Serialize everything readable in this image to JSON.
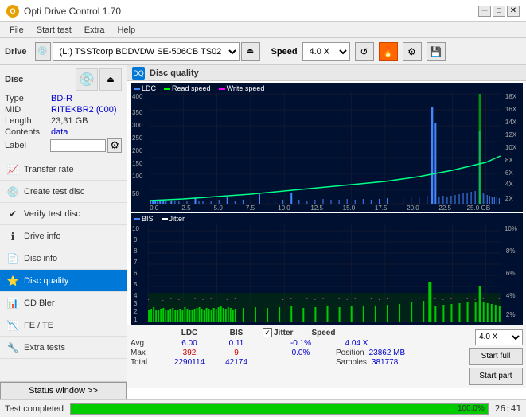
{
  "titlebar": {
    "title": "Opti Drive Control 1.70",
    "logo": "O",
    "min": "─",
    "max": "□",
    "close": "✕"
  },
  "menu": {
    "items": [
      "File",
      "Start test",
      "Extra",
      "Help"
    ]
  },
  "toolbar": {
    "drive_label": "Drive",
    "drive_value": "(L:)  TSSTcorp BDDVDW SE-506CB TS02",
    "speed_label": "Speed",
    "speed_value": "4.0 X"
  },
  "disc": {
    "header": "Disc",
    "type_label": "Type",
    "type_value": "BD-R",
    "mid_label": "MID",
    "mid_value": "RITEKBR2 (000)",
    "length_label": "Length",
    "length_value": "23,31 GB",
    "contents_label": "Contents",
    "contents_value": "data",
    "label_label": "Label",
    "label_value": ""
  },
  "nav": {
    "items": [
      {
        "id": "transfer-rate",
        "label": "Transfer rate",
        "icon": "📈"
      },
      {
        "id": "create-test-disc",
        "label": "Create test disc",
        "icon": "💿"
      },
      {
        "id": "verify-test-disc",
        "label": "Verify test disc",
        "icon": "✔"
      },
      {
        "id": "drive-info",
        "label": "Drive info",
        "icon": "ℹ"
      },
      {
        "id": "disc-info",
        "label": "Disc info",
        "icon": "📄"
      },
      {
        "id": "disc-quality",
        "label": "Disc quality",
        "icon": "⭐",
        "active": true
      },
      {
        "id": "cd-bler",
        "label": "CD Bler",
        "icon": "📊"
      },
      {
        "id": "fe-te",
        "label": "FE / TE",
        "icon": "📉"
      },
      {
        "id": "extra-tests",
        "label": "Extra tests",
        "icon": "🔧"
      }
    ]
  },
  "status_btn": "Status window >>",
  "dq": {
    "title": "Disc quality",
    "legend1": [
      {
        "label": "LDC",
        "color": "#4444ff"
      },
      {
        "label": "Read speed",
        "color": "#00ff00"
      },
      {
        "label": "Write speed",
        "color": "#ff00ff"
      }
    ],
    "legend2": [
      {
        "label": "BIS",
        "color": "#4444ff"
      },
      {
        "label": "Jitter",
        "color": "#ffffff"
      }
    ],
    "y_labels_chart1": [
      "400",
      "350",
      "300",
      "250",
      "200",
      "150",
      "100",
      "50"
    ],
    "y_labels_chart1_right": [
      "18X",
      "16X",
      "14X",
      "12X",
      "10X",
      "8X",
      "6X",
      "4X",
      "2X"
    ],
    "y_labels_chart2": [
      "10",
      "9",
      "8",
      "7",
      "6",
      "5",
      "4",
      "3",
      "2",
      "1"
    ],
    "y_labels_chart2_right": [
      "10%",
      "8%",
      "6%",
      "4%",
      "2%"
    ],
    "x_labels": [
      "0.0",
      "2.5",
      "5.0",
      "7.5",
      "10.0",
      "12.5",
      "15.0",
      "17.5",
      "20.0",
      "22.5",
      "25.0 GB"
    ]
  },
  "stats": {
    "col_headers": [
      "LDC",
      "BIS",
      "",
      "Jitter",
      "Speed"
    ],
    "avg_label": "Avg",
    "avg_ldc": "6.00",
    "avg_bis": "0.11",
    "avg_jitter": "-0.1%",
    "avg_speed": "4.04 X",
    "max_label": "Max",
    "max_ldc": "392",
    "max_ldc_color": "red",
    "max_bis": "9",
    "max_bis_color": "red",
    "max_jitter": "0.0%",
    "total_label": "Total",
    "total_ldc": "2290114",
    "total_bis": "42174",
    "position_label": "Position",
    "position_value": "23862 MB",
    "samples_label": "Samples",
    "samples_value": "381778",
    "speed_select": "4.0 X",
    "jitter_checked": true,
    "jitter_label": "Jitter"
  },
  "buttons": {
    "start_full": "Start full",
    "start_part": "Start part"
  },
  "statusbar": {
    "text": "Test completed",
    "progress": 100,
    "time": "26:41"
  },
  "colors": {
    "active_nav": "#0078d7",
    "chart_bg": "#1a1a3e",
    "ldc_color": "#5555ff",
    "read_speed_color": "#00ff00",
    "bis_color": "#5555ff",
    "green_bars": "#00dd00",
    "accent": "#0078d7"
  }
}
